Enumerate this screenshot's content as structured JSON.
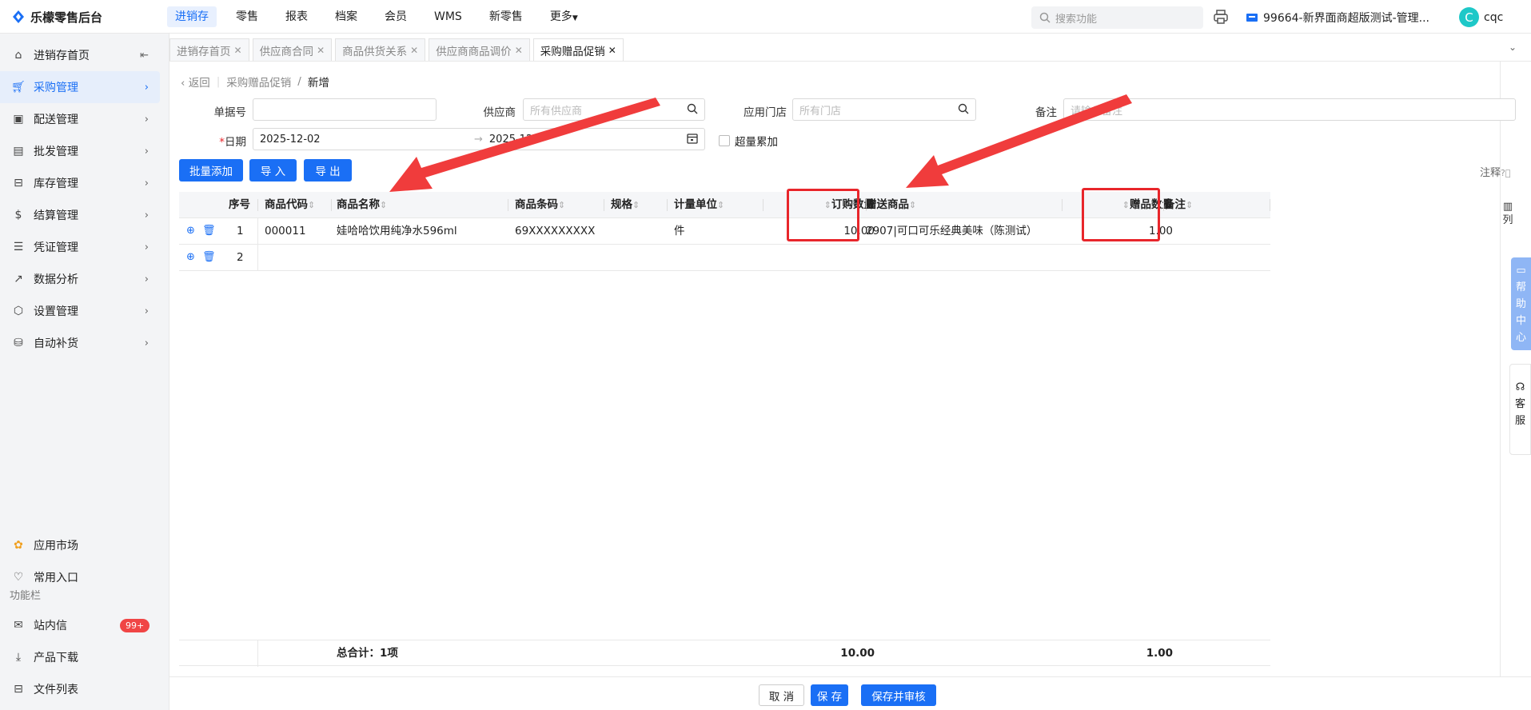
{
  "app": {
    "title": "乐檬零售后台"
  },
  "nav": [
    "进销存",
    "零售",
    "报表",
    "档案",
    "会员",
    "WMS",
    "新零售",
    "更多"
  ],
  "search": {
    "placeholder": "搜索功能"
  },
  "store": "99664-新界面商超版测试-管理...",
  "user": {
    "avatar": "C",
    "name": "cqc"
  },
  "sidebar": {
    "items": [
      {
        "label": "进销存首页",
        "icon": "home-icon"
      },
      {
        "label": "采购管理",
        "icon": "cart-icon"
      },
      {
        "label": "配送管理",
        "icon": "delivery-icon"
      },
      {
        "label": "批发管理",
        "icon": "wallet-icon"
      },
      {
        "label": "库存管理",
        "icon": "box-icon"
      },
      {
        "label": "结算管理",
        "icon": "dollar-icon"
      },
      {
        "label": "凭证管理",
        "icon": "document-icon"
      },
      {
        "label": "数据分析",
        "icon": "chart-icon"
      },
      {
        "label": "设置管理",
        "icon": "settings-icon"
      },
      {
        "label": "自动补货",
        "icon": "restock-icon"
      }
    ],
    "bottom": [
      {
        "label": "应用市场",
        "icon": "apps-icon"
      },
      {
        "label": "常用入口",
        "icon": "heart-icon"
      }
    ],
    "section": "功能栏",
    "func": [
      {
        "label": "站内信",
        "icon": "mail-icon",
        "badge": "99+"
      },
      {
        "label": "产品下载",
        "icon": "download-icon"
      },
      {
        "label": "文件列表",
        "icon": "list-icon"
      }
    ]
  },
  "tabs": [
    {
      "label": "进销存首页"
    },
    {
      "label": "供应商合同"
    },
    {
      "label": "商品供货关系"
    },
    {
      "label": "供应商商品调价"
    },
    {
      "label": "采购赠品促销"
    }
  ],
  "breadcrumb": {
    "back": "返回",
    "parent": "采购赠品促销",
    "current": "新增"
  },
  "form": {
    "doc_no": {
      "label": "单据号",
      "value": ""
    },
    "supplier": {
      "label": "供应商",
      "placeholder": "所有供应商"
    },
    "store": {
      "label": "应用门店",
      "placeholder": "所有门店"
    },
    "remark": {
      "label": "备注",
      "placeholder": "请输入备注"
    },
    "date": {
      "label": "日期",
      "required": "*",
      "start": "2025-12-02",
      "end": "2025-12"
    },
    "over": {
      "label": "超量累加"
    }
  },
  "buttons": {
    "batch_add": "批量添加",
    "import": "导 入",
    "export": "导 出",
    "note": "注释"
  },
  "table": {
    "headers": [
      "序号",
      "商品代码",
      "商品名称",
      "商品条码",
      "规格",
      "计量单位",
      "订购数量",
      "赠送商品",
      "赠品数量",
      "备注"
    ],
    "rows": [
      {
        "seq": "1",
        "code": "000011",
        "name": "娃哈哈饮用纯净水596ml",
        "barcode": "69XXXXXXXXX",
        "spec": "",
        "unit": "件",
        "qty": "10.00",
        "gift": "2907|可口可乐经典美味（陈测试）",
        "gift_qty": "1.00",
        "remark": ""
      },
      {
        "seq": "2"
      }
    ],
    "footer": {
      "label": "总合计：1项",
      "qty": "10.00",
      "gift_qty": "1.00"
    }
  },
  "right": {
    "columns": "列",
    "help": [
      "帮",
      "助",
      "中",
      "心"
    ],
    "kefu": [
      "客",
      "服"
    ]
  },
  "bottom_buttons": {
    "cancel": "取 消",
    "save": "保 存",
    "save_audit": "保存并审核"
  },
  "colors": {
    "accent": "#1a6ff5",
    "highlight": "#e8262b"
  }
}
